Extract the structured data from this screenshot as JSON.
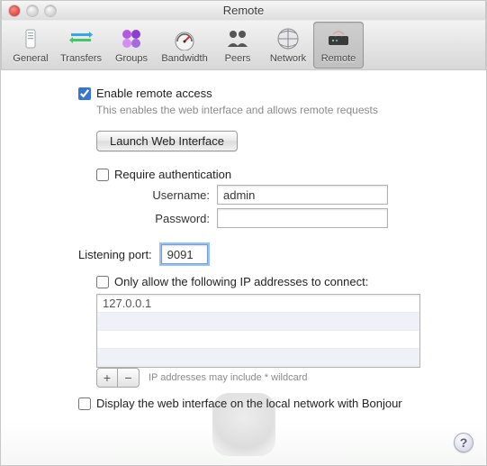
{
  "window": {
    "title": "Remote"
  },
  "toolbar": {
    "items": [
      {
        "label": "General"
      },
      {
        "label": "Transfers"
      },
      {
        "label": "Groups"
      },
      {
        "label": "Bandwidth"
      },
      {
        "label": "Peers"
      },
      {
        "label": "Network"
      },
      {
        "label": "Remote"
      }
    ]
  },
  "remote": {
    "enable_label": "Enable remote access",
    "enable_hint": "This enables the web interface and allows remote requests",
    "launch_button": "Launch Web Interface",
    "require_auth_label": "Require authentication",
    "username_label": "Username:",
    "username_value": "admin",
    "password_label": "Password:",
    "password_value": "",
    "port_label": "Listening port:",
    "port_value": "9091",
    "ip_allow_label": "Only allow the following IP addresses to connect:",
    "ip_entries": [
      "127.0.0.1"
    ],
    "ip_hint": "IP addresses may include * wildcard",
    "bonjour_label": "Display the web interface on the local network with Bonjour"
  },
  "checks": {
    "enable": true,
    "require_auth": false,
    "ip_allow": false,
    "bonjour": false
  }
}
